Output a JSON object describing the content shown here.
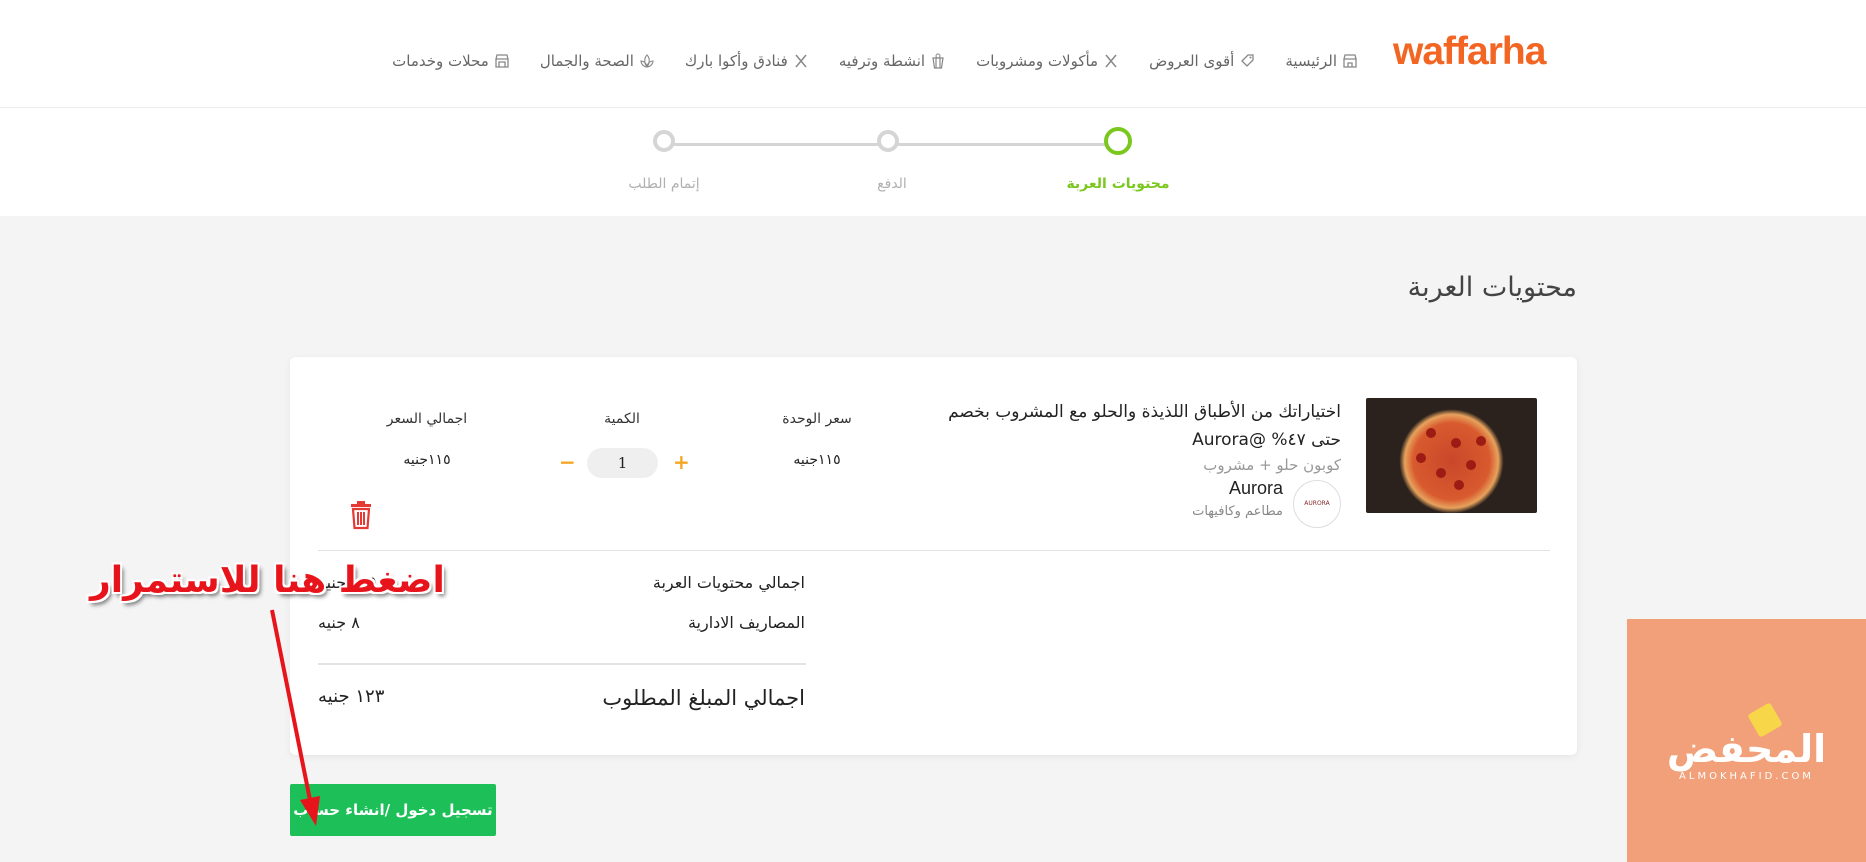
{
  "header": {
    "logo": "waffarha",
    "nav": [
      {
        "label": "الرئيسية",
        "icon": "store-icon"
      },
      {
        "label": "أقوى العروض",
        "icon": "tag-icon"
      },
      {
        "label": "مأكولات ومشروبات",
        "icon": "utensils-icon"
      },
      {
        "label": "انشطة وترفيه",
        "icon": "popcorn-icon"
      },
      {
        "label": "فنادق وأكوا بارك",
        "icon": "utensils-icon"
      },
      {
        "label": "الصحة والجمال",
        "icon": "lotus-icon"
      },
      {
        "label": "محلات وخدمات",
        "icon": "shop-icon"
      }
    ]
  },
  "stepper": {
    "steps": [
      {
        "label": "محتويات العربة",
        "state": "active"
      },
      {
        "label": "الدفع",
        "state": "inactive"
      },
      {
        "label": "إتمام الطلب",
        "state": "inactive"
      }
    ],
    "active_color": "#7ac81e",
    "inactive_color": "#d5d5d5"
  },
  "page_title": "محتويات العربة",
  "cart_item": {
    "title": "اختياراتك من الأطباق اللذيذة والحلو مع المشروب بخصم حتى ٤٧% @Aurora",
    "subtitle": "كوبون حلو + مشروب",
    "brand_name": "Aurora",
    "brand_category": "مطاعم وكافيهات",
    "brand_logo_text": "AURORA",
    "columns": {
      "unit_price_label": "سعر الوحدة",
      "quantity_label": "الكمية",
      "total_label": "اجمالي السعر"
    },
    "unit_price": "١١٥جنيه",
    "quantity": "1",
    "plus": "+",
    "minus": "−",
    "total_price": "١١٥جنيه"
  },
  "summary": {
    "cart_total_label": "اجمالي محتويات العربة",
    "cart_total_value": "١١٥ جنيه",
    "fees_label": "المصاريف الادارية",
    "fees_value": "٨ جنيه",
    "grand_total_label": "اجمالي المبلغ المطلوب",
    "grand_total_value": "١٢٣ جنيه"
  },
  "cta": {
    "label": "تسجيل دخول /انشاء حساب"
  },
  "annotation": {
    "text": "اضغط هنا للاستمرار",
    "color": "#e8141c"
  },
  "watermark": {
    "text": "المحفض",
    "sub": "ALMOKHAFID.COM"
  },
  "colors": {
    "brand": "#f26522",
    "cta": "#1dbf58",
    "qty_buttons": "#f5a623",
    "trash": "#e53935"
  }
}
